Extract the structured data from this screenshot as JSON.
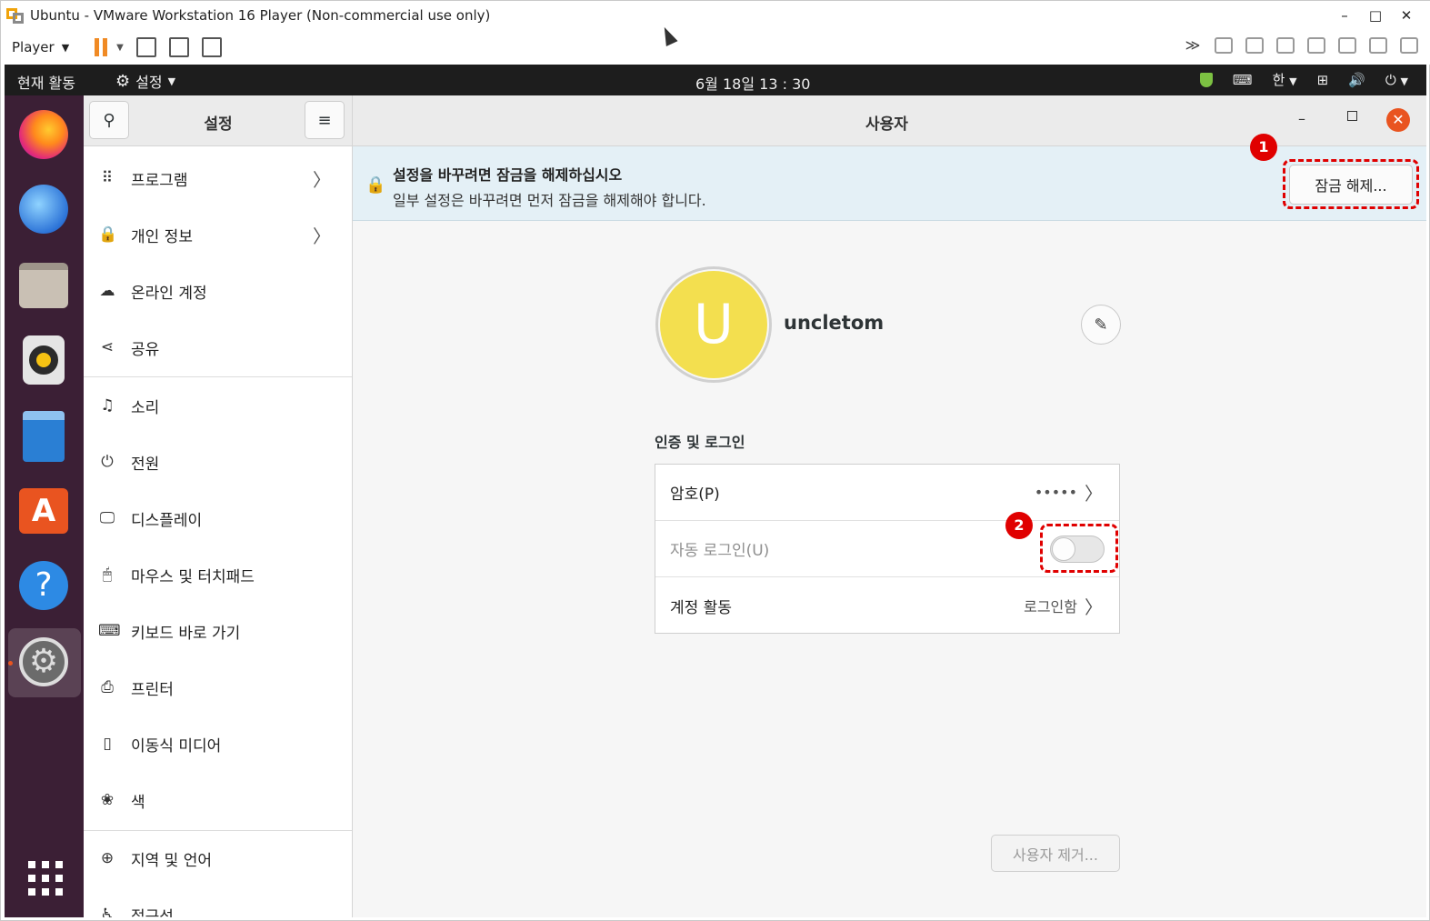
{
  "window": {
    "title": "Ubuntu - VMware Workstation 16 Player (Non-commercial use only)",
    "min": "–",
    "max": "□",
    "close": "✕"
  },
  "vm_toolbar": {
    "player_label": "Player"
  },
  "topbar": {
    "activities": "현재 활동",
    "app_name": "설정",
    "clock": "6월 18일  13 : 30",
    "ime": "한"
  },
  "sidebar": {
    "title": "설정",
    "items": [
      {
        "label": "프로그램",
        "icon": "apps-grid-icon",
        "glyph": "⠿",
        "chevron": true
      },
      {
        "label": "개인 정보",
        "icon": "lock-icon",
        "glyph": "🔒",
        "chevron": true
      },
      {
        "label": "온라인 계정",
        "icon": "cloud-icon",
        "glyph": "☁",
        "chevron": false
      },
      {
        "label": "공유",
        "icon": "share-icon",
        "glyph": "⋖",
        "chevron": false
      },
      {
        "label": "소리",
        "icon": "music-note-icon",
        "glyph": "♫",
        "chevron": false
      },
      {
        "label": "전원",
        "icon": "power-icon",
        "glyph": "⏻",
        "chevron": false
      },
      {
        "label": "디스플레이",
        "icon": "display-icon",
        "glyph": "🖵",
        "chevron": false
      },
      {
        "label": "마우스 및 터치패드",
        "icon": "mouse-icon",
        "glyph": "🖱",
        "chevron": false
      },
      {
        "label": "키보드 바로 가기",
        "icon": "keyboard-icon",
        "glyph": "⌨",
        "chevron": false
      },
      {
        "label": "프린터",
        "icon": "printer-icon",
        "glyph": "⎙",
        "chevron": false
      },
      {
        "label": "이동식 미디어",
        "icon": "usb-media-icon",
        "glyph": "▯",
        "chevron": false
      },
      {
        "label": "색",
        "icon": "color-icon",
        "glyph": "❀",
        "chevron": false
      },
      {
        "label": "지역 및 언어",
        "icon": "globe-icon",
        "glyph": "⊕",
        "chevron": false
      },
      {
        "label": "접근성",
        "icon": "accessibility-icon",
        "glyph": "♿",
        "chevron": false
      }
    ]
  },
  "main": {
    "title": "사용자",
    "infobar": {
      "title": "설정을 바꾸려면 잠금을 해제하십시오",
      "subtitle": "일부 설정은 바꾸려면 먼저 잠금을 해제해야 합니다.",
      "unlock_button": "잠금 해제..."
    },
    "user": {
      "avatar_letter": "U",
      "name": "uncletom"
    },
    "auth_section": {
      "title": "인증 및 로그인",
      "rows": [
        {
          "label": "암호(P)",
          "value": "•••••",
          "type": "link"
        },
        {
          "label": "자동 로그인(U)",
          "value": "",
          "type": "toggle",
          "checked": false
        },
        {
          "label": "계정 활동",
          "value": "로그인함",
          "type": "link"
        }
      ]
    },
    "remove_button": "사용자 제거..."
  },
  "annotations": {
    "badge_1": "1",
    "badge_2": "2",
    "highlight_color": "#e00000"
  },
  "colors": {
    "accent": "#e95420",
    "avatar_bg": "#f3df4f",
    "dock_bg": "#3b1f35",
    "infobar_bg": "#e4f0f6"
  }
}
